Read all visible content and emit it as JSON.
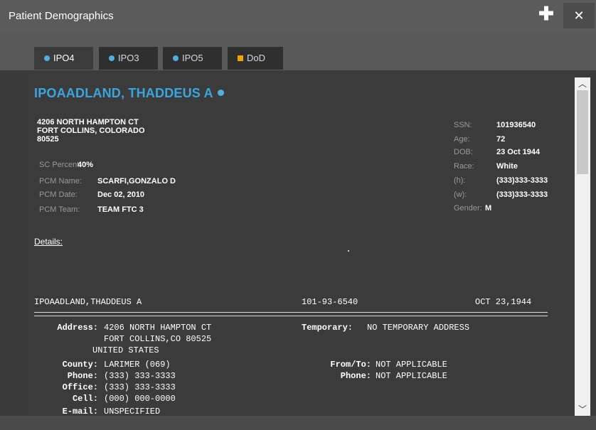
{
  "window": {
    "title": "Patient Demographics",
    "plus_glyph": "✚",
    "close_glyph": "✕"
  },
  "tabs": [
    {
      "label": "IPO4",
      "marker": "dot"
    },
    {
      "label": "IPO3",
      "marker": "dot"
    },
    {
      "label": "IPO5",
      "marker": "dot"
    },
    {
      "label": "DoD",
      "marker": "square"
    }
  ],
  "colors": {
    "accent": "#3aa6e0",
    "dod_marker": "#f0a500"
  },
  "patient": {
    "name": "IPOAADLAND, THADDEUS A",
    "address": [
      "4206 NORTH HAMPTON CT",
      "FORT COLLINS, COLORADO",
      "80525"
    ],
    "left_fields": [
      {
        "label": "SC Percent:",
        "value": "40%"
      },
      {
        "label": "PCM Name:",
        "value": "SCARFI,GONZALO D"
      },
      {
        "label": "PCM Date:",
        "value": "Dec 02, 2010"
      },
      {
        "label": "PCM Team:",
        "value": "TEAM FTC 3"
      }
    ],
    "right_fields": [
      {
        "label": "SSN:",
        "value": "101936540"
      },
      {
        "label": "Age:",
        "value": "72"
      },
      {
        "label": "DOB:",
        "value": "23 Oct 1944"
      },
      {
        "label": "Race:",
        "value": "White"
      },
      {
        "label": "(h):",
        "value": "(333)333-3333"
      },
      {
        "label": "(w):",
        "value": "(333)333-3333"
      },
      {
        "label": "Gender:",
        "value": "M"
      }
    ]
  },
  "details": {
    "heading": "Details:",
    "header_name": "IPOAADLAND,THADDEUS A",
    "header_ssn": "101-93-6540",
    "header_dob": "OCT 23,1944",
    "left_lines": [
      {
        "label": "Address:",
        "value": "4206 NORTH HAMPTON CT"
      },
      {
        "label": "",
        "value": "FORT COLLINS,CO 80525"
      },
      {
        "label": "",
        "value": "UNITED STATES"
      },
      {
        "label": "County:",
        "value": "LARIMER (069)"
      },
      {
        "label": "Phone:",
        "value": "(333) 333-3333"
      },
      {
        "label": "Office:",
        "value": "(333) 333-3333"
      },
      {
        "label": "Cell:",
        "value": "(000) 000-0000"
      },
      {
        "label": "E-mail:",
        "value": "UNSPECIFIED"
      }
    ],
    "right_lines": [
      {
        "label": "Temporary:",
        "value": "NO TEMPORARY ADDRESS"
      },
      {
        "label": "",
        "value": ""
      },
      {
        "label": "",
        "value": ""
      },
      {
        "label": "From/To:",
        "value": "NOT APPLICABLE"
      },
      {
        "label": "Phone:",
        "value": "NOT APPLICABLE"
      }
    ]
  },
  "scrollbar": {
    "up_glyph": "︿",
    "down_glyph": "﹀"
  }
}
